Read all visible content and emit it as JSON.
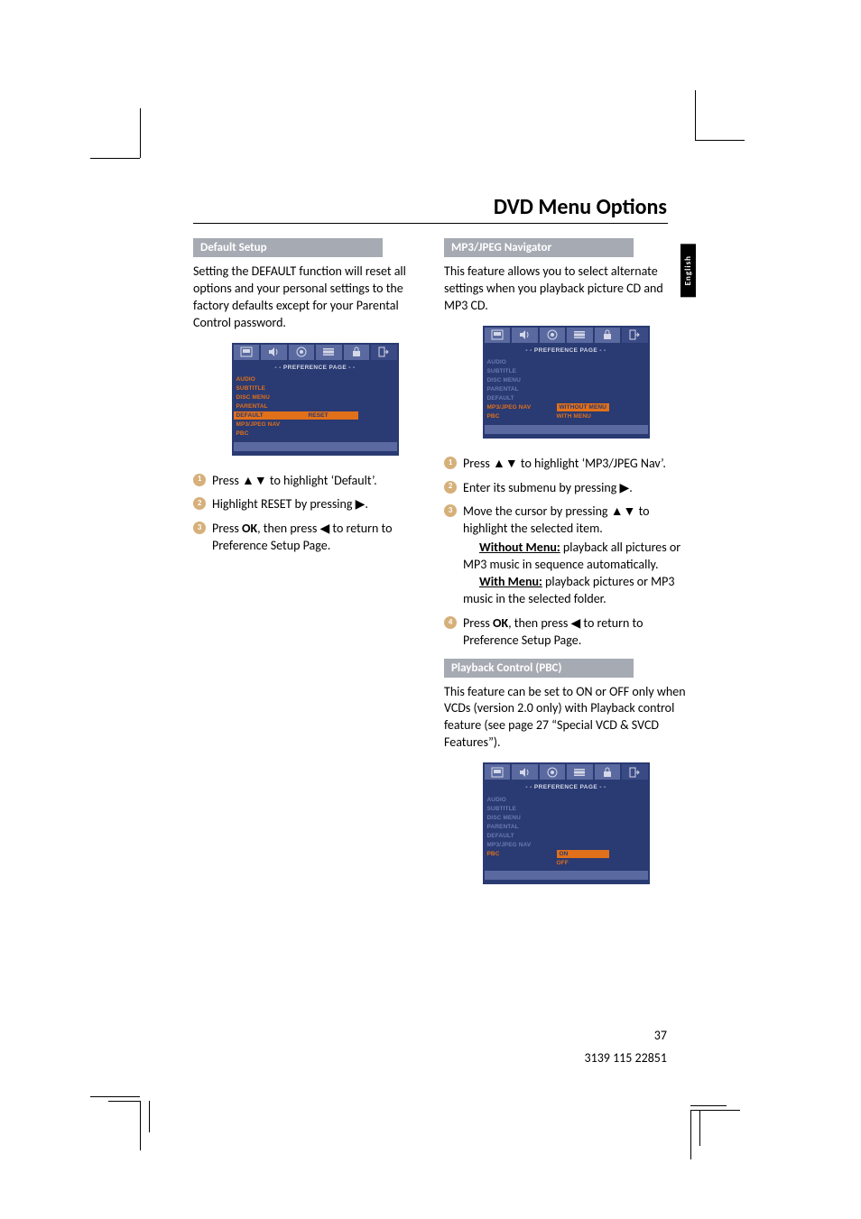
{
  "page_title": "DVD Menu Options",
  "language_tab": "English",
  "page_number": "37",
  "doc_id": "3139 115 22851",
  "left": {
    "heading": "Default Setup",
    "intro": "Setting the DEFAULT function will reset all options and your personal settings to the factory defaults except for your Parental Control password.",
    "osd": {
      "title": "- -   PREFERENCE  PAGE   - -",
      "items": [
        "AUDIO",
        "SUBTITLE",
        "DISC MENU",
        "PARENTAL",
        "DEFAULT",
        "MP3/JPEG NAV",
        "PBC"
      ],
      "selected_index": 4,
      "selected_right": "RESET"
    },
    "steps": [
      "Press ▲▼ to highlight ‘Default’.",
      "Highlight RESET by pressing ▶.",
      "Press OK, then press ◀ to return to Preference Setup Page."
    ]
  },
  "right": {
    "heading1": "MP3/JPEG Navigator",
    "intro1": "This feature allows you to select alternate settings when you playback picture CD and MP3 CD.",
    "osd1": {
      "title": "- -   PREFERENCE  PAGE   - -",
      "items": [
        "AUDIO",
        "SUBTITLE",
        "DISC MENU",
        "PARENTAL",
        "DEFAULT",
        "MP3/JPEG NAV",
        "PBC"
      ],
      "selected_index": 5,
      "right_options": [
        "WITHOUT MENU",
        "WITH MENU"
      ],
      "right_selected": 0
    },
    "steps1": {
      "s1": "Press ▲▼ to highlight ‘MP3/JPEG Nav’.",
      "s2": "Enter its submenu by pressing ▶.",
      "s3": "Move the cursor by pressing ▲▼ to highlight the selected item.",
      "s3_wo_label": "Without Menu:",
      "s3_wo_text": " playback all pictures or MP3 music in sequence automatically.",
      "s3_wm_label": "With Menu:",
      "s3_wm_text": " playback pictures or MP3 music in the selected folder.",
      "s4": "Press OK, then press ◀ to return to Preference Setup Page."
    },
    "heading2": "Playback Control (PBC)",
    "intro2": "This feature can be set to ON or OFF only when VCDs (version 2.0 only) with Playback control feature (see page 27 “Special VCD & SVCD Features”).",
    "osd2": {
      "title": "- -   PREFERENCE  PAGE   - -",
      "items": [
        "AUDIO",
        "SUBTITLE",
        "DISC MENU",
        "PARENTAL",
        "DEFAULT",
        "MP3/JPEG NAV",
        "PBC"
      ],
      "selected_index": 6,
      "right_options": [
        "ON",
        "OFF"
      ],
      "right_selected": 0
    }
  }
}
